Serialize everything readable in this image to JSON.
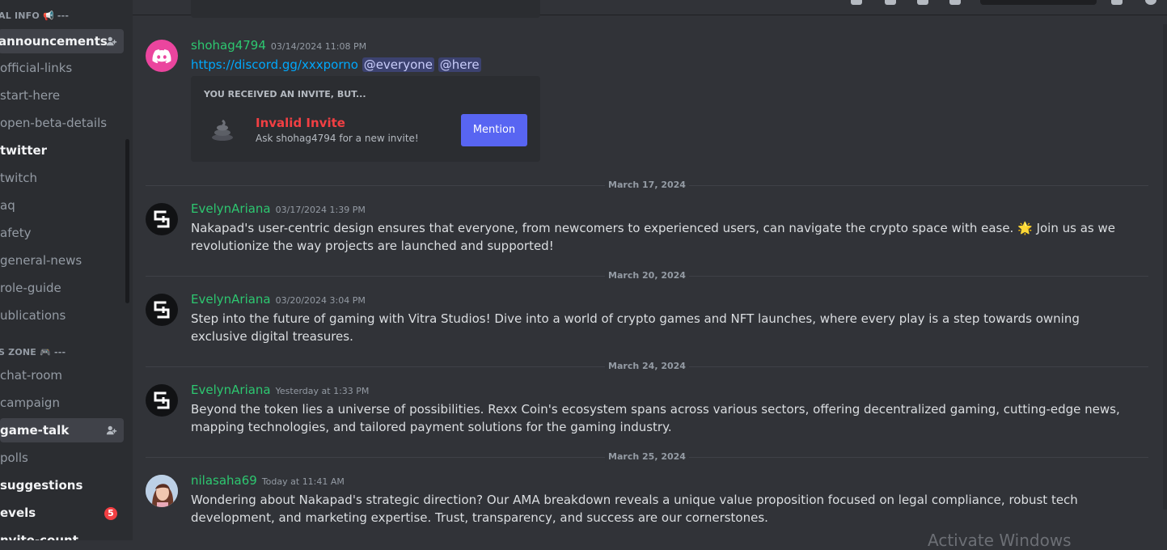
{
  "sidebar": {
    "categories": [
      {
        "label": "AL INFO 📢 ---"
      },
      {
        "label": "S ZONE 🎮 ---"
      }
    ],
    "channels": [
      {
        "label": "announcements"
      },
      {
        "label": "official-links"
      },
      {
        "label": "start-here"
      },
      {
        "label": "open-beta-details"
      },
      {
        "label": "twitter"
      },
      {
        "label": "twitch"
      },
      {
        "label": "aq"
      },
      {
        "label": "afety"
      },
      {
        "label": "general-news"
      },
      {
        "label": "role-guide"
      },
      {
        "label": "ublications"
      },
      {
        "label": "chat-room"
      },
      {
        "label": "campaign"
      },
      {
        "label": "game-talk"
      },
      {
        "label": "polls"
      },
      {
        "label": "suggestions"
      },
      {
        "label": "evels",
        "badge": "5"
      },
      {
        "label": "nvite-count"
      }
    ]
  },
  "messages": [
    {
      "author": "shohag4794",
      "timestamp": "03/14/2024 11:08 PM",
      "link": "https://discord.gg/xxxporno",
      "mentions": [
        "@everyone",
        "@here"
      ],
      "invite": {
        "header": "YOU RECEIVED AN INVITE, BUT...",
        "title": "Invalid Invite",
        "subtitle": "Ask shohag4794 for a new invite!",
        "button": "Mention"
      }
    },
    {
      "divider": "March 17, 2024",
      "author": "EvelynAriana",
      "timestamp": "03/17/2024 1:39 PM",
      "text_before": "Nakapad's user-centric design ensures that everyone, from newcomers to experienced users, can navigate the crypto space with ease.",
      "emoji": "🌟",
      "text_after": "Join us as we revolutionize the way projects are launched and supported!"
    },
    {
      "divider": "March 20, 2024",
      "author": "EvelynAriana",
      "timestamp": "03/20/2024 3:04 PM",
      "text": "Step into the future of gaming with Vitra Studios! Dive into a world of crypto games and NFT launches, where every play is a step towards owning exclusive digital treasures."
    },
    {
      "divider": "March 24, 2024",
      "author": "EvelynAriana",
      "timestamp": "Yesterday at 1:33 PM",
      "text": "Beyond the token lies a universe of possibilities. Rexx Coin's ecosystem spans across various sectors, offering decentralized gaming, cutting-edge news, mapping technologies, and tailored payment solutions for the gaming industry."
    },
    {
      "divider": "March 25, 2024",
      "author": "nilasaha69",
      "timestamp": "Today at 11:41 AM",
      "text": "Wondering about Nakapad's strategic direction? Our AMA breakdown reveals a unique value proposition focused on legal compliance, robust tech development, and marketing expertise. Trust, transparency, and success are our cornerstones."
    }
  ],
  "watermark": "Activate Windows",
  "colors": {
    "blurple": "#5865f2",
    "username_green": "#2dc770",
    "danger": "#f23f43",
    "link": "#00a8fc"
  }
}
